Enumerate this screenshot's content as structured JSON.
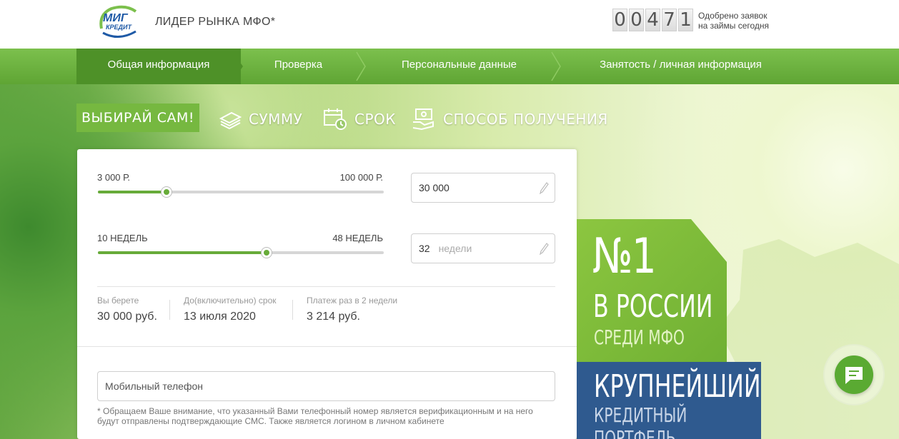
{
  "header": {
    "logo_line1": "МИГ",
    "logo_line2": "КРЕДИТ",
    "tagline": "ЛИДЕР РЫНКА МФО*",
    "counter_digits": [
      "0",
      "0",
      "4",
      "7",
      "1"
    ],
    "counter_label_line1": "Одобрено заявок",
    "counter_label_line2": "на займы сегодня"
  },
  "nav": {
    "items": [
      {
        "label": "Общая информация",
        "active": true
      },
      {
        "label": "Проверка",
        "active": false
      },
      {
        "label": "Персональные данные",
        "active": false
      },
      {
        "label": "Занятость / личная информация",
        "active": false
      }
    ]
  },
  "choose": {
    "tag": "ВЫБИРАЙ САМ!",
    "options": [
      {
        "label": "СУММУ",
        "icon": "money-stack-icon"
      },
      {
        "label": "СРОК",
        "icon": "calendar-clock-icon"
      },
      {
        "label": "СПОСОБ ПОЛУЧЕНИЯ",
        "icon": "cash-hand-icon"
      }
    ]
  },
  "form": {
    "amount": {
      "min_label": "3 000 Р.",
      "max_label": "100 000 Р.",
      "value": "30 000",
      "level": 0.24
    },
    "term": {
      "min_label": "10 НЕДЕЛЬ",
      "max_label": "48 НЕДЕЛЬ",
      "value": "32",
      "unit": "недели",
      "level": 0.59
    },
    "summary": [
      {
        "label": "Вы берете",
        "value": "30 000 руб."
      },
      {
        "label": "До(включительно) срок",
        "value": "13 июля 2020"
      },
      {
        "label": "Платеж раз в 2 недели",
        "value": "3 214 руб."
      }
    ],
    "phone_placeholder": "Мобильный телефон",
    "note": "* Обращаем Ваше внимание, что указанный Вами телефонный номер является верификационным и на него будут отправлены подтверждающие СМС. Также является логином в личном кабинете"
  },
  "promo": {
    "number": "№1",
    "line1": "В РОССИИ",
    "line2": "СРЕДИ МФО",
    "line3": "КРУПНЕЙШИЙ",
    "line4": "КРЕДИТНЫЙ",
    "line5": "ПОРТФЕЛЬ"
  },
  "colors": {
    "brand_green": "#67ab39",
    "nav_active": "#4e9128",
    "promo_blue": "#2f5a8f",
    "logo_blue": "#1f5aa6"
  }
}
